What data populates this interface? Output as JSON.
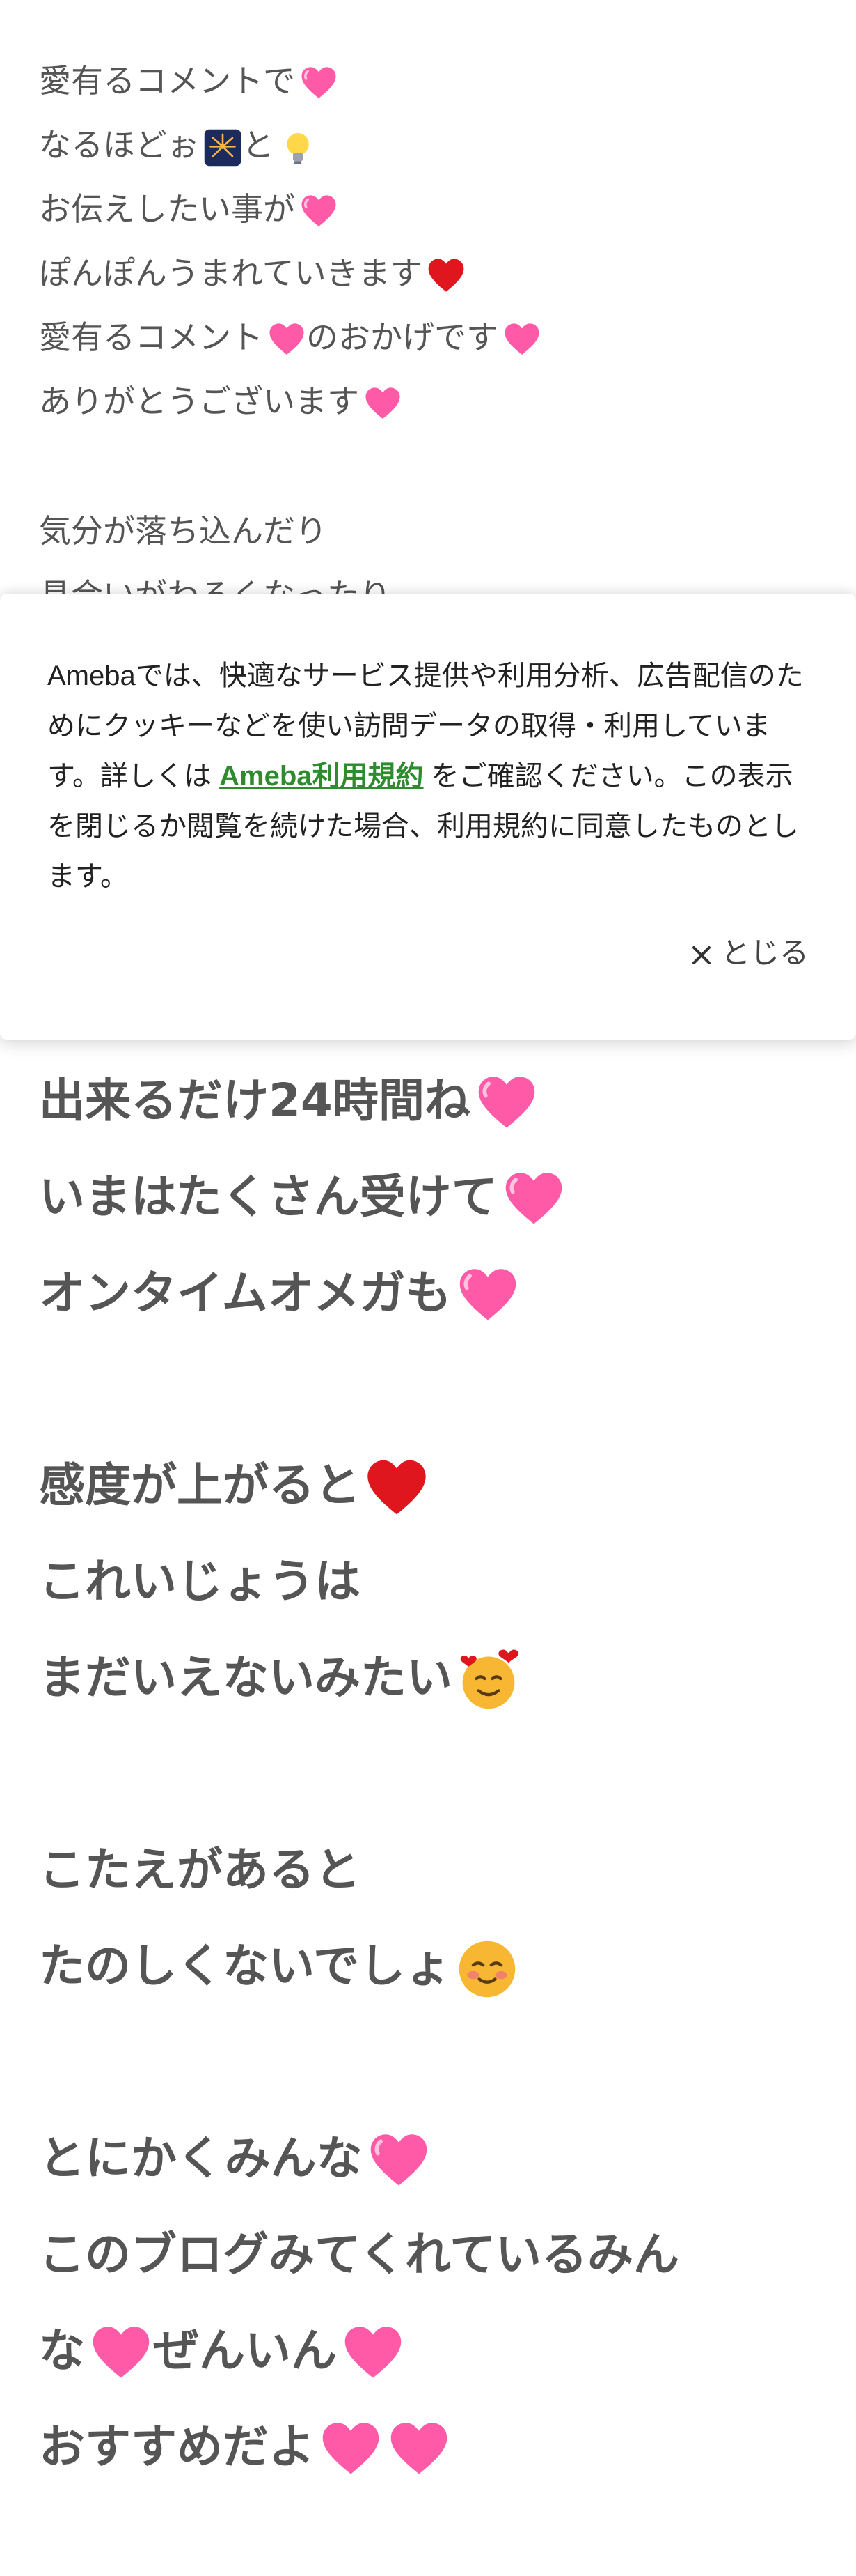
{
  "blog": {
    "normal_lines": [
      {
        "text": "愛有るコメントで",
        "emojis": [
          "pink-heart"
        ]
      },
      {
        "text": "なるほどぉ",
        "emojis": [
          "fireworks"
        ],
        "after": "と",
        "emojis_after": [
          "lightbulb"
        ]
      },
      {
        "text": "お伝えしたい事が",
        "emojis": [
          "pink-heart"
        ]
      },
      {
        "text": "ぽんぽんうまれていきます",
        "emojis": [
          "red-heart"
        ]
      },
      {
        "text": "愛有るコメント",
        "emojis": [
          "pink-heart"
        ],
        "after": "のおかげです",
        "emojis_after": [
          "pink-heart"
        ]
      },
      {
        "text": "ありがとうございます",
        "emojis": [
          "pink-heart"
        ]
      },
      {
        "text": "気分が落ち込んだり"
      },
      {
        "text": "具合いがわるくなったり"
      }
    ],
    "bold_lines": [
      {
        "text": "出来るだけ24時間ね",
        "emojis": [
          "pink-heart"
        ]
      },
      {
        "text": "いまはたくさん受けて",
        "emojis": [
          "pink-heart"
        ]
      },
      {
        "text": "オンタイムオメガも",
        "emojis": [
          "pink-heart"
        ]
      },
      {
        "text": "感度が上がると",
        "emojis": [
          "red-heart"
        ]
      },
      {
        "text": "これいじょうは"
      },
      {
        "text": "まだいえないみたい",
        "emojis": [
          "smiling-hearts"
        ]
      },
      {
        "text": "こたえがあると"
      },
      {
        "text": "たのしくないでしょ",
        "emojis": [
          "blush"
        ]
      },
      {
        "text": "とにかくみんな",
        "emojis": [
          "pink-heart"
        ]
      },
      {
        "text": "このブログみてくれているみん"
      },
      {
        "text": "な",
        "emojis": [
          "pink-heart"
        ],
        "after": "ぜんいん",
        "emojis_after": [
          "pink-heart"
        ]
      },
      {
        "text": "おすすめだよ",
        "emojis": [
          "pink-heart",
          "pink-heart"
        ]
      }
    ]
  },
  "cookie_banner": {
    "text_before": "Amebaでは、快適なサービス提供や利用分析、広告配信のためにクッキーなどを使い訪問データの取得・利用しています。詳しくは ",
    "link_text": "Ameba利用規約",
    "text_after": " をご確認ください。この表示を閉じるか閲覧を続けた場合、利用規約に同意したものとします。",
    "close_label": "とじる"
  },
  "colors": {
    "text": "#555555",
    "link": "#2e8b2e",
    "pink_heart": "#ff5aa8",
    "red_heart": "#e0161e"
  }
}
